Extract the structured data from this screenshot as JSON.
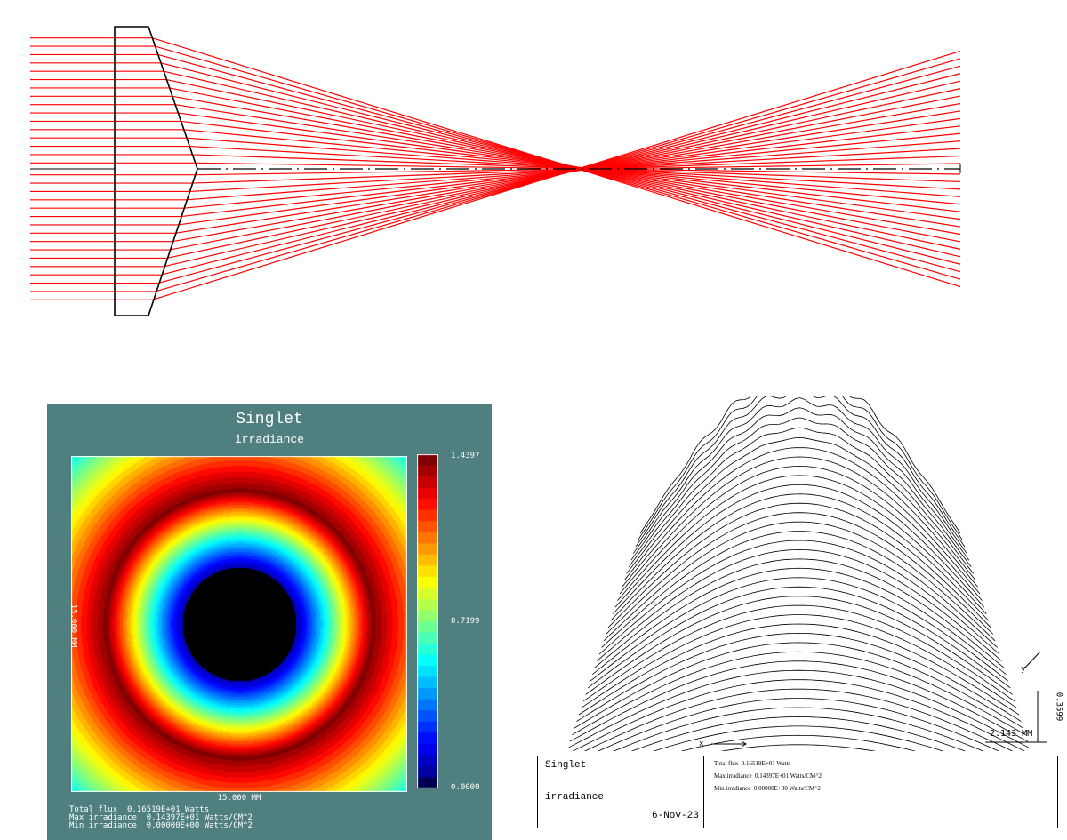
{
  "raytrace": {
    "ray_color": "#ff0000",
    "lens_color": "#000000",
    "axis_color": "#000000"
  },
  "irradiance_plot": {
    "title": "Singlet",
    "subtitle": "irradiance",
    "x_dimension": "15.000 MM",
    "y_dimension": "15.000 MM",
    "scale_labels": {
      "max": "1.4397",
      "mid": "0.7199",
      "min": "0.0000"
    },
    "stats": [
      "Total flux  0.16519E+01 Watts",
      "Max irradiance  0.14397E+01 Watts/CM^2",
      "Min irradiance  0.00000E+00 Watts/CM^2"
    ],
    "background_color": "#4f7f7f"
  },
  "surface_plot": {
    "x_scale": "2.143 MM",
    "z_scale": "0.3599",
    "x_axis_label": "x",
    "y_axis_label": "y",
    "info": {
      "title": "Singlet",
      "subtitle": "irradiance",
      "date": "6-Nov-23",
      "stats": [
        "Total flux  0.16519E+01 Watts",
        "Max irradiance  0.14397E+01 Watts/CM^2",
        "Min irradiance  0.00000E+00 Watts/CM^2"
      ]
    }
  }
}
